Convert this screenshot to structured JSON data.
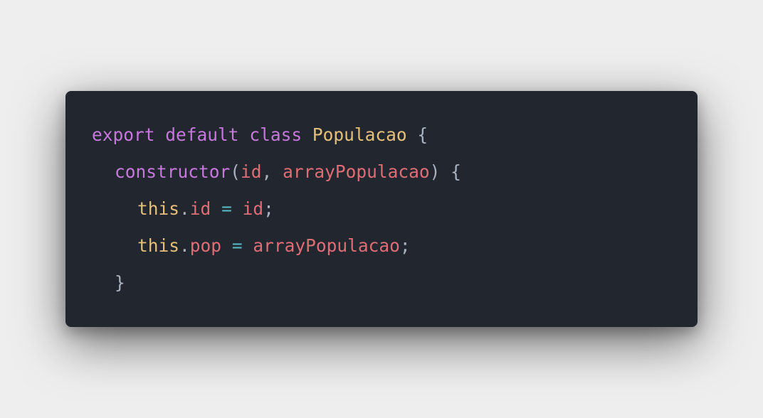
{
  "colors": {
    "background": "#eeeeee",
    "editor_background": "#22262e",
    "keyword": "#c678dd",
    "class_name": "#e5c07b",
    "this_keyword": "#e5c07b",
    "variable": "#e06c75",
    "operator": "#56b6c2",
    "punctuation": "#abb2bf"
  },
  "code": {
    "line1": {
      "export": "export",
      "default": "default",
      "class": "class",
      "class_name": "Populacao",
      "open_brace": "{"
    },
    "line2": {
      "constructor": "constructor",
      "open_paren": "(",
      "param1": "id",
      "comma": ",",
      "param2": "arrayPopulacao",
      "close_paren": ")",
      "open_brace": "{"
    },
    "line3": {
      "this": "this",
      "dot": ".",
      "property": "id",
      "equals": "=",
      "value": "id",
      "semicolon": ";"
    },
    "line4": {
      "this": "this",
      "dot": ".",
      "property": "pop",
      "equals": "=",
      "value": "arrayPopulacao",
      "semicolon": ";"
    },
    "line5": {
      "close_brace": "}"
    }
  }
}
